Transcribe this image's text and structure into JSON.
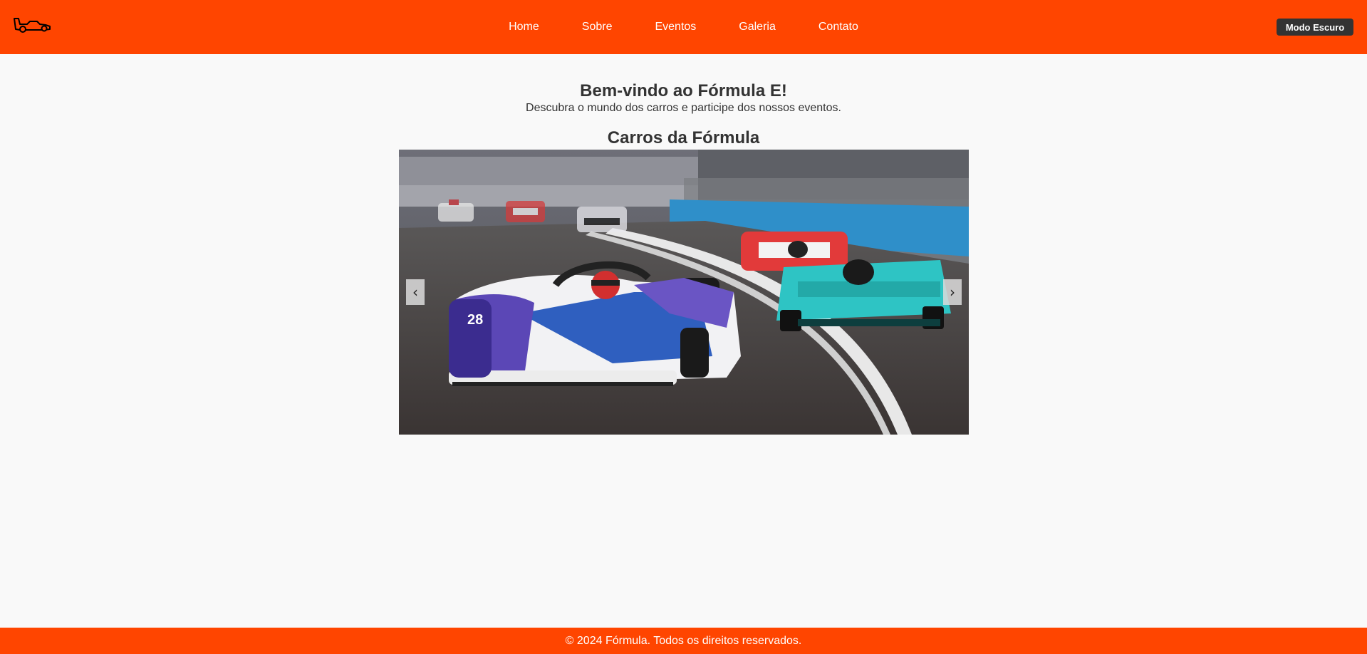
{
  "header": {
    "logo_icon": "race-car-icon",
    "nav": [
      {
        "label": "Home"
      },
      {
        "label": "Sobre"
      },
      {
        "label": "Eventos"
      },
      {
        "label": "Galeria"
      },
      {
        "label": "Contato"
      }
    ],
    "dark_mode_label": "Modo Escuro"
  },
  "welcome": {
    "title": "Bem-vindo ao Fórmula E!",
    "subtitle": "Descubra o mundo dos carros e participe dos nossos eventos."
  },
  "carousel": {
    "title": "Carros da Fórmula",
    "prev_label": "‹",
    "next_label": "›"
  },
  "footer": {
    "text": "© 2024 Fórmula. Todos os direitos reservados."
  },
  "colors": {
    "brand": "#ff4500",
    "button_dark": "#333333",
    "background": "#f9f9f9"
  }
}
